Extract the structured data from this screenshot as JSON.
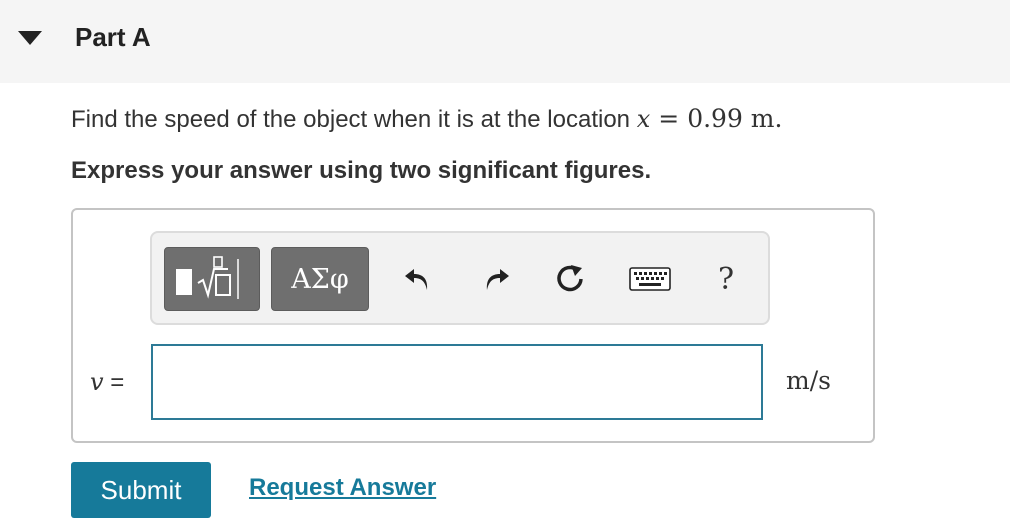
{
  "part": {
    "title": "Part A"
  },
  "question": {
    "prefix": "Find the speed of the object when it is at the location ",
    "variable": "x",
    "equals": "=",
    "value": "0.99 m."
  },
  "instruction": "Express your answer using two significant figures.",
  "toolbar": {
    "greek_label": "ΑΣφ",
    "help_label": "?",
    "icons": [
      "templates-icon",
      "undo-icon",
      "redo-icon",
      "reset-icon",
      "keyboard-icon",
      "help-icon"
    ]
  },
  "answer": {
    "variable": "v",
    "equals": " =",
    "value": "",
    "units": "m/s"
  },
  "actions": {
    "submit_label": "Submit",
    "request_answer_label": "Request Answer"
  },
  "colors": {
    "accent": "#167a9a",
    "input_border": "#2d7a96",
    "header_bg": "#f5f5f5",
    "toolbar_button": "#6f6f6f"
  }
}
